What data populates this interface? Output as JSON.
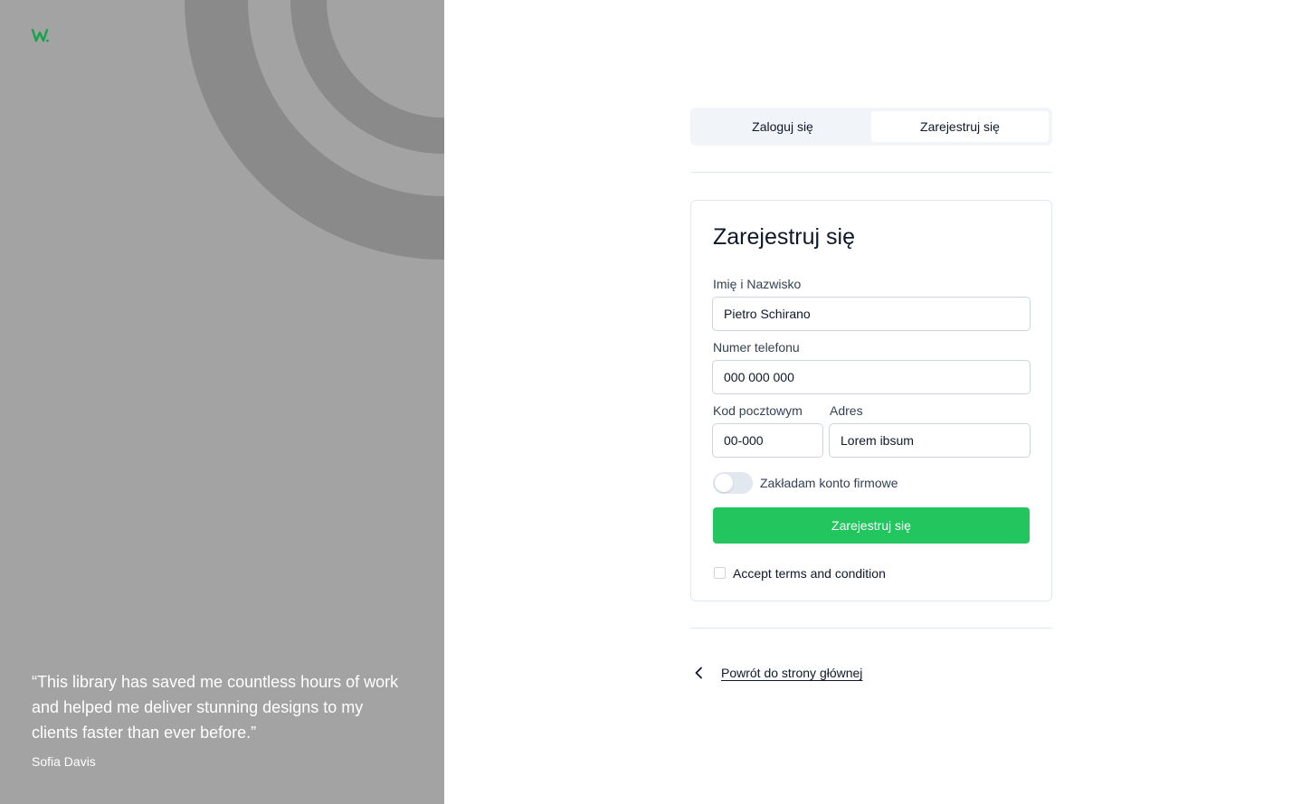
{
  "brand": {
    "logo_text": "W.",
    "accent_color": "#22c55e",
    "panel_color": "#a3a3a3"
  },
  "testimonial": {
    "quote": "“This library has saved me countless hours of work and helped me deliver stunning designs to my clients faster than ever before.”",
    "author": "Sofia Davis"
  },
  "tabs": [
    {
      "label": "Zaloguj się",
      "active": false
    },
    {
      "label": "Zarejestruj się",
      "active": true
    }
  ],
  "form": {
    "title": "Zarejestruj się",
    "fields": {
      "name": {
        "label": "Imię i Nazwisko",
        "value": "Pietro Schirano"
      },
      "phone": {
        "label": "Numer telefonu",
        "value": "000 000 000"
      },
      "postal": {
        "label": "Kod pocztowym",
        "value": "00-000"
      },
      "address": {
        "label": "Adres",
        "value": "Lorem ibsum"
      }
    },
    "company_toggle": {
      "label": "Zakładam konto firmowe",
      "checked": false
    },
    "submit_label": "Zarejestruj się",
    "terms": {
      "label": "Accept terms and condition",
      "checked": false
    }
  },
  "back_link": {
    "label": "Powrót do strony głównej",
    "icon": "chevron-left-icon"
  }
}
